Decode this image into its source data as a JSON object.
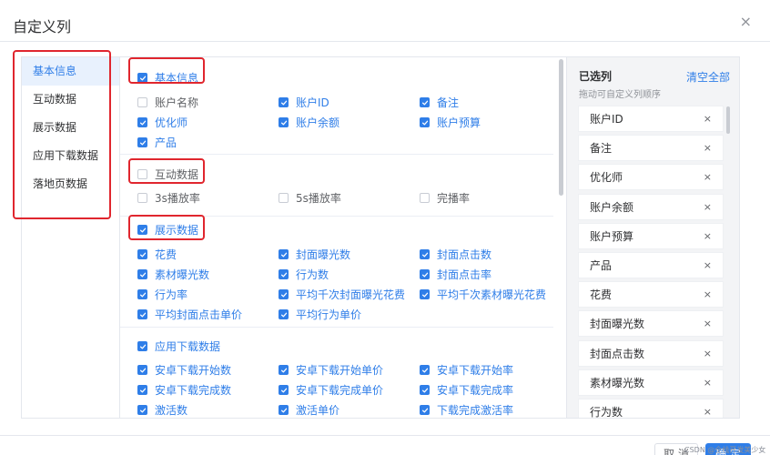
{
  "dialog": {
    "title": "自定义列",
    "close_glyph": "×"
  },
  "categories": [
    {
      "label": "基本信息",
      "active": true
    },
    {
      "label": "互动数据",
      "active": false
    },
    {
      "label": "展示数据",
      "active": false
    },
    {
      "label": "应用下载数据",
      "active": false
    },
    {
      "label": "落地页数据",
      "active": false
    }
  ],
  "sections": {
    "basic": {
      "header": {
        "label": "基本信息",
        "checked": true
      },
      "options": [
        {
          "label": "账户名称",
          "checked": false
        },
        {
          "label": "账户ID",
          "checked": true
        },
        {
          "label": "备注",
          "checked": true
        },
        {
          "label": "优化师",
          "checked": true
        },
        {
          "label": "账户余额",
          "checked": true
        },
        {
          "label": "账户预算",
          "checked": true
        },
        {
          "label": "产品",
          "checked": true
        }
      ]
    },
    "interaction": {
      "header": {
        "label": "互动数据",
        "checked": false
      },
      "options": [
        {
          "label": "3s播放率",
          "checked": false
        },
        {
          "label": "5s播放率",
          "checked": false
        },
        {
          "label": "完播率",
          "checked": false
        }
      ]
    },
    "display": {
      "header": {
        "label": "展示数据",
        "checked": true
      },
      "options": [
        {
          "label": "花费",
          "checked": true
        },
        {
          "label": "封面曝光数",
          "checked": true
        },
        {
          "label": "封面点击数",
          "checked": true
        },
        {
          "label": "素材曝光数",
          "checked": true
        },
        {
          "label": "行为数",
          "checked": true
        },
        {
          "label": "封面点击率",
          "checked": true
        },
        {
          "label": "行为率",
          "checked": true
        },
        {
          "label": "平均千次封面曝光花费",
          "checked": true
        },
        {
          "label": "平均千次素材曝光花费",
          "checked": true
        },
        {
          "label": "平均封面点击单价",
          "checked": true
        },
        {
          "label": "平均行为单价",
          "checked": true
        }
      ]
    },
    "download": {
      "header": {
        "label": "应用下载数据",
        "checked": true
      },
      "options": [
        {
          "label": "安卓下载开始数",
          "checked": true
        },
        {
          "label": "安卓下载开始单价",
          "checked": true
        },
        {
          "label": "安卓下载开始率",
          "checked": true
        },
        {
          "label": "安卓下载完成数",
          "checked": true
        },
        {
          "label": "安卓下载完成单价",
          "checked": true
        },
        {
          "label": "安卓下载完成率",
          "checked": true
        },
        {
          "label": "激活数",
          "checked": true
        },
        {
          "label": "激活单价",
          "checked": true
        },
        {
          "label": "下载完成激活率",
          "checked": true
        }
      ]
    }
  },
  "selected_panel": {
    "title": "已选列",
    "hint": "拖动可自定义列顺序",
    "clear_all": "清空全部",
    "remove_glyph": "×",
    "items": [
      "账户ID",
      "备注",
      "优化师",
      "账户余额",
      "账户预算",
      "产品",
      "花费",
      "封面曝光数",
      "封面点击数",
      "素材曝光数",
      "行为数"
    ]
  },
  "footer": {
    "cancel": "取 消",
    "ok": "确 定"
  },
  "watermark": "CSDN @全栈开发美少女",
  "colors": {
    "accent": "#2f7ee8",
    "annotation": "#e0262e",
    "panel_bg": "#f3f4f6"
  }
}
